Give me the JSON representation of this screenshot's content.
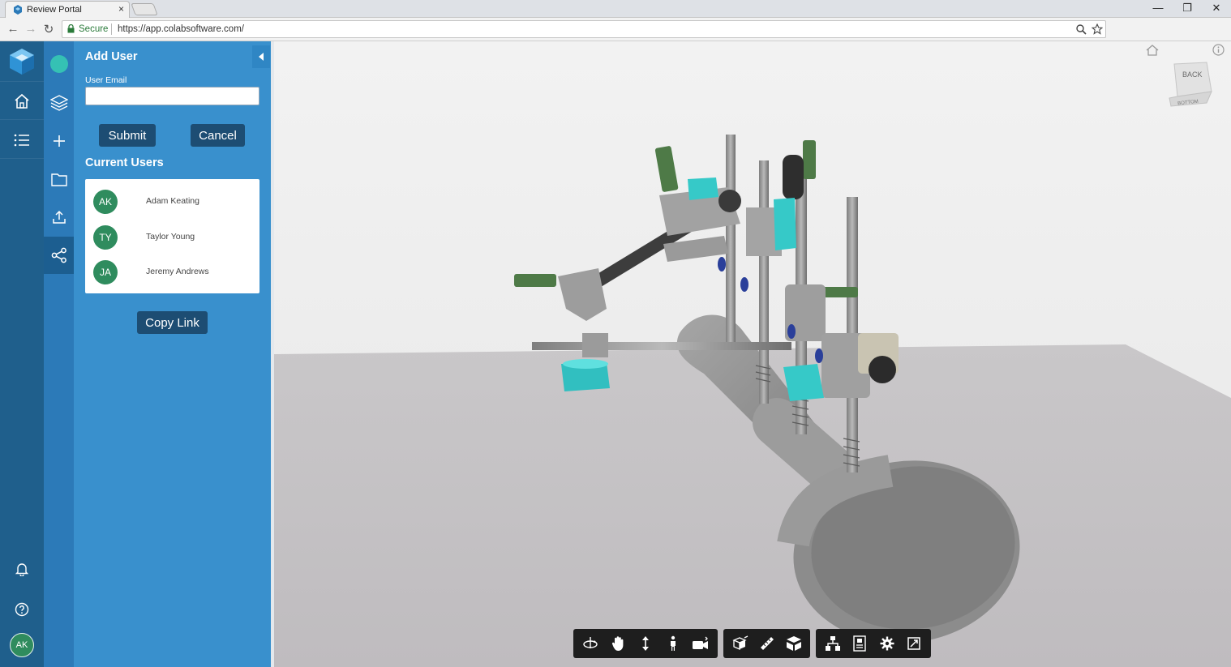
{
  "browser": {
    "tab_title": "Review Portal",
    "tab_close": "×",
    "secure_label": "Secure",
    "url": "https://app.colabsoftware.com/",
    "window_controls": [
      "—",
      "❐",
      "✕"
    ]
  },
  "rail": {
    "main_items": [
      "logo-icon",
      "home-icon",
      "list-icon"
    ],
    "secondary_items": [
      "status-dot",
      "layers-icon",
      "add-icon",
      "folder-icon",
      "upload-icon",
      "share-icon"
    ],
    "active_secondary": "share-icon",
    "bottom_items": [
      "bell-icon",
      "help-icon"
    ],
    "user_initials": "AK"
  },
  "add_user": {
    "title": "Add User",
    "email_label": "User Email",
    "email_value": "",
    "submit_label": "Submit",
    "cancel_label": "Cancel"
  },
  "current_users": {
    "title": "Current Users",
    "users": [
      {
        "initials": "AK",
        "name": "Adam Keating"
      },
      {
        "initials": "TY",
        "name": "Taylor Young"
      },
      {
        "initials": "JA",
        "name": "Jeremy Andrews"
      }
    ]
  },
  "copy_link_label": "Copy Link",
  "viewport": {
    "view_cube_faces": [
      "BACK",
      "BOTTOM"
    ],
    "toolbar_groups": [
      [
        "orbit-icon",
        "pan-icon",
        "zoom-icon",
        "walk-icon",
        "camera-icon"
      ],
      [
        "explode-icon",
        "measure-icon",
        "section-icon"
      ],
      [
        "model-browser-icon",
        "properties-icon",
        "settings-icon",
        "fullscreen-icon"
      ]
    ]
  },
  "colors": {
    "rail_dark": "#1f5f8c",
    "rail_mid": "#2c7ab8",
    "panel": "#3990cd",
    "button_dark": "#1d4d73",
    "avatar_green": "#2f8c5e",
    "teal": "#35c1b4"
  }
}
